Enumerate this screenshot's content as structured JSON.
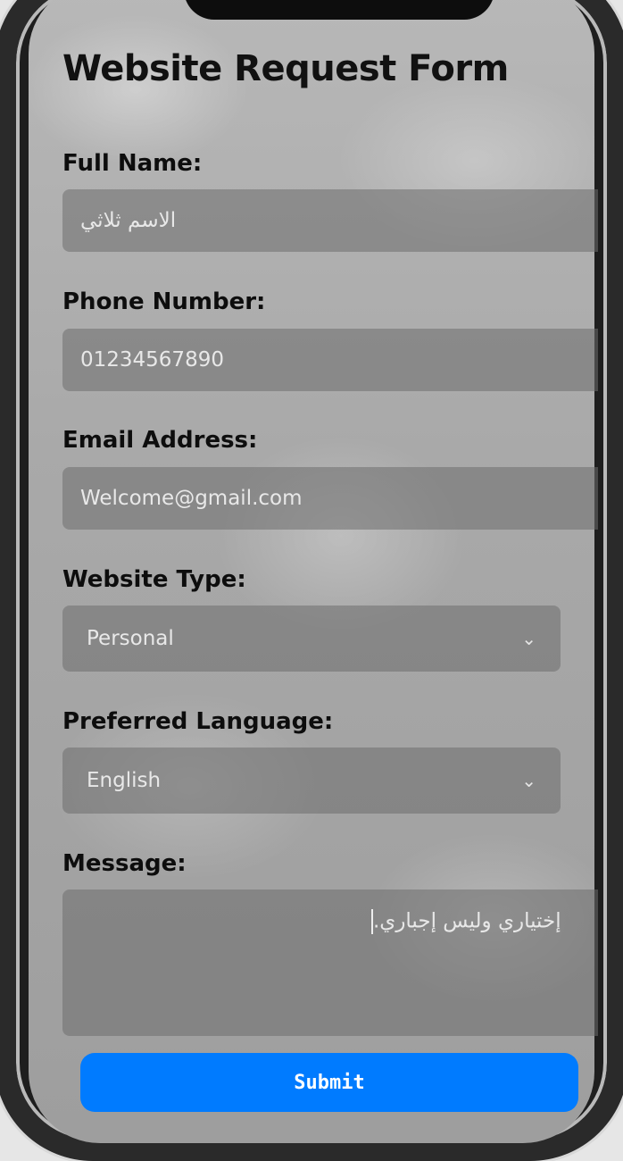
{
  "form": {
    "title": "Website Request Form",
    "full_name": {
      "label": "Full Name:",
      "value": "الاسم ثلاثي"
    },
    "phone": {
      "label": "Phone Number:",
      "value": "01234567890"
    },
    "email": {
      "label": "Email Address:",
      "value": "Welcome@gmail.com"
    },
    "website_type": {
      "label": "Website Type:",
      "value": "Personal"
    },
    "language": {
      "label": "Preferred Language:",
      "value": "English"
    },
    "message": {
      "label": "Message:",
      "value": "إختياري وليس إجباري."
    },
    "submit_label": "Submit"
  },
  "icons": {
    "select_arrow": "chevron-down-icon"
  },
  "colors": {
    "accent": "#007bff"
  }
}
